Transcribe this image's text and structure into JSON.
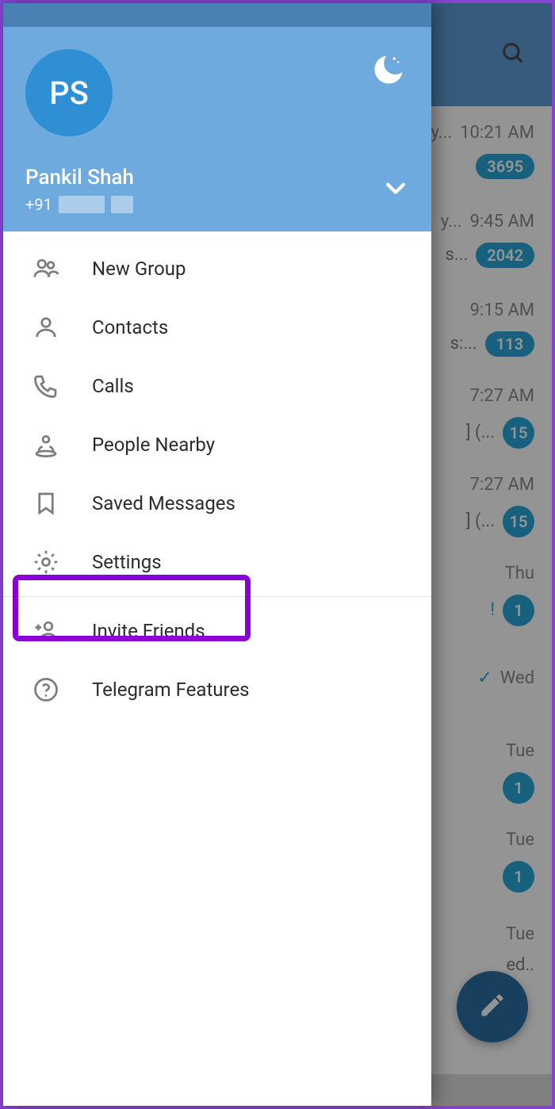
{
  "drawer": {
    "avatar_initials": "PS",
    "user_name": "Pankil Shah",
    "phone_prefix": "+91",
    "menu": [
      {
        "id": "new-group",
        "label": "New Group"
      },
      {
        "id": "contacts",
        "label": "Contacts"
      },
      {
        "id": "calls",
        "label": "Calls"
      },
      {
        "id": "people-nearby",
        "label": "People Nearby"
      },
      {
        "id": "saved-messages",
        "label": "Saved Messages"
      },
      {
        "id": "settings",
        "label": "Settings"
      },
      {
        "id": "invite-friends",
        "label": "Invite Friends"
      },
      {
        "id": "telegram-features",
        "label": "Telegram Features"
      }
    ]
  },
  "chats": [
    {
      "preview": "y...",
      "sub": "",
      "time": "10:21 AM",
      "badge": "3695"
    },
    {
      "preview": "y...",
      "sub": "s...",
      "time": "9:45 AM",
      "badge": "2042"
    },
    {
      "preview": "",
      "sub": "s:...",
      "time": "9:15 AM",
      "badge": "113"
    },
    {
      "preview": "] (...",
      "sub": "",
      "time": "7:27 AM",
      "badge": "15"
    },
    {
      "preview": "] (...",
      "sub": "",
      "time": "7:27 AM",
      "badge": "15"
    },
    {
      "preview": "!",
      "sub": "",
      "time": "Thu",
      "badge": "1"
    },
    {
      "preview": "",
      "sub": "",
      "time": "Wed",
      "badge": "",
      "check": true
    },
    {
      "preview": "",
      "sub": "",
      "time": "Tue",
      "badge": "1"
    },
    {
      "preview": "",
      "sub": "",
      "time": "Tue",
      "badge": "1"
    },
    {
      "preview": "ed..",
      "sub": "",
      "time": "Tue",
      "badge": ""
    }
  ],
  "highlight": {
    "target": "settings"
  }
}
